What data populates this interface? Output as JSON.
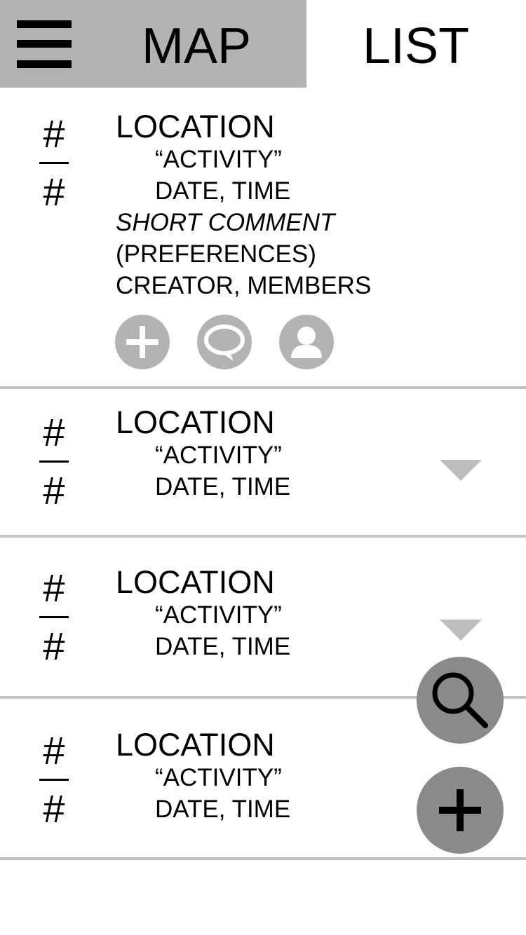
{
  "header": {
    "map_label": "MAP",
    "list_label": "LIST",
    "map_tab_color": "#b3b3b3"
  },
  "items": [
    {
      "fraction_top": "#",
      "fraction_bottom": "#",
      "location": "LOCATION",
      "activity": "“ACTIVITY”",
      "datetime": "DATE, TIME",
      "comment": "SHORT COMMENT",
      "preferences": "(PREFERENCES)",
      "people": "CREATOR, MEMBERS",
      "expanded": true
    },
    {
      "fraction_top": "#",
      "fraction_bottom": "#",
      "location": "LOCATION",
      "activity": "“ACTIVITY”",
      "datetime": "DATE, TIME",
      "expanded": false
    },
    {
      "fraction_top": "#",
      "fraction_bottom": "#",
      "location": "LOCATION",
      "activity": "“ACTIVITY”",
      "datetime": "DATE, TIME",
      "expanded": false
    },
    {
      "fraction_top": "#",
      "fraction_bottom": "#",
      "location": "LOCATION",
      "activity": "“ACTIVITY”",
      "datetime": "DATE, TIME",
      "expanded": false
    }
  ],
  "actions": [
    "add-icon",
    "comment-icon",
    "profile-icon"
  ],
  "fabs": [
    "search-icon",
    "add-icon"
  ]
}
